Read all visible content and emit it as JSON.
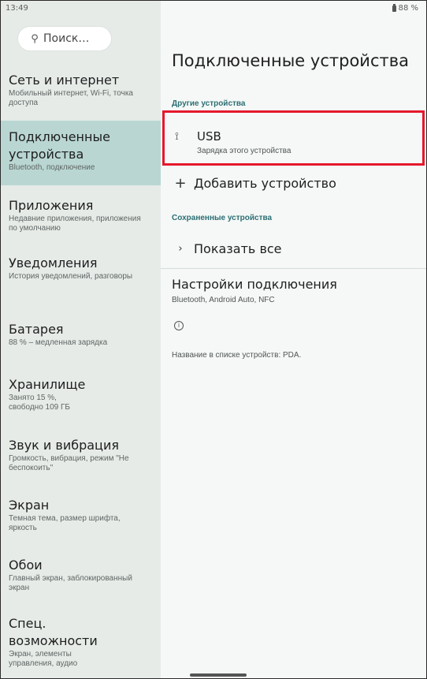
{
  "status_bar": {
    "time": "13:49",
    "battery": "88 %"
  },
  "search": {
    "label": "Поиск…"
  },
  "nav": {
    "items": [
      {
        "title": "Сеть и интернет",
        "subtitle": "Мобильный интернет, Wi-Fi, точка доступа"
      },
      {
        "title": "Подключенные устройства",
        "subtitle": "Bluetooth, подключение"
      },
      {
        "title": "Приложения",
        "subtitle": "Недавние приложения, приложения по умолчанию"
      },
      {
        "title": "Уведомления",
        "subtitle": "История уведомлений, разговоры"
      },
      {
        "title": "Батарея",
        "subtitle": "88 % – медленная зарядка"
      },
      {
        "title": "Хранилище",
        "subtitle": "Занято 15 %, свободно 109 ГБ"
      },
      {
        "title": "Звук и вибрация",
        "subtitle": "Громкость, вибрация, режим \"Не беспокоить\""
      },
      {
        "title": "Экран",
        "subtitle": "Темная тема, размер шрифта, яркость"
      },
      {
        "title": "Обои",
        "subtitle": "Главный экран, заблокированный экран"
      },
      {
        "title": "Спец. возможности",
        "subtitle": "Экран, элементы управления, аудио"
      }
    ]
  },
  "main": {
    "title": "Подключенные устройства",
    "other_devices_label": "Другие устройства",
    "usb": {
      "title": "USB",
      "subtitle": "Зарядка этого устройства"
    },
    "add_device": "Добавить устройство",
    "saved_devices_label": "Сохраненные устройства",
    "show_all": "Показать все",
    "connection_settings": {
      "title": "Настройки подключения",
      "subtitle": "Bluetooth, Android Auto, NFC"
    },
    "device_name": "Название в списке устройств: PDA."
  },
  "colors": {
    "accent": "#2c6e74",
    "active_nav": "#b9d6d2",
    "highlight": "#e5182d"
  },
  "icons": [
    "search-icon",
    "usb-icon",
    "plus-icon",
    "chevron-right-icon",
    "info-icon",
    "battery-icon"
  ]
}
